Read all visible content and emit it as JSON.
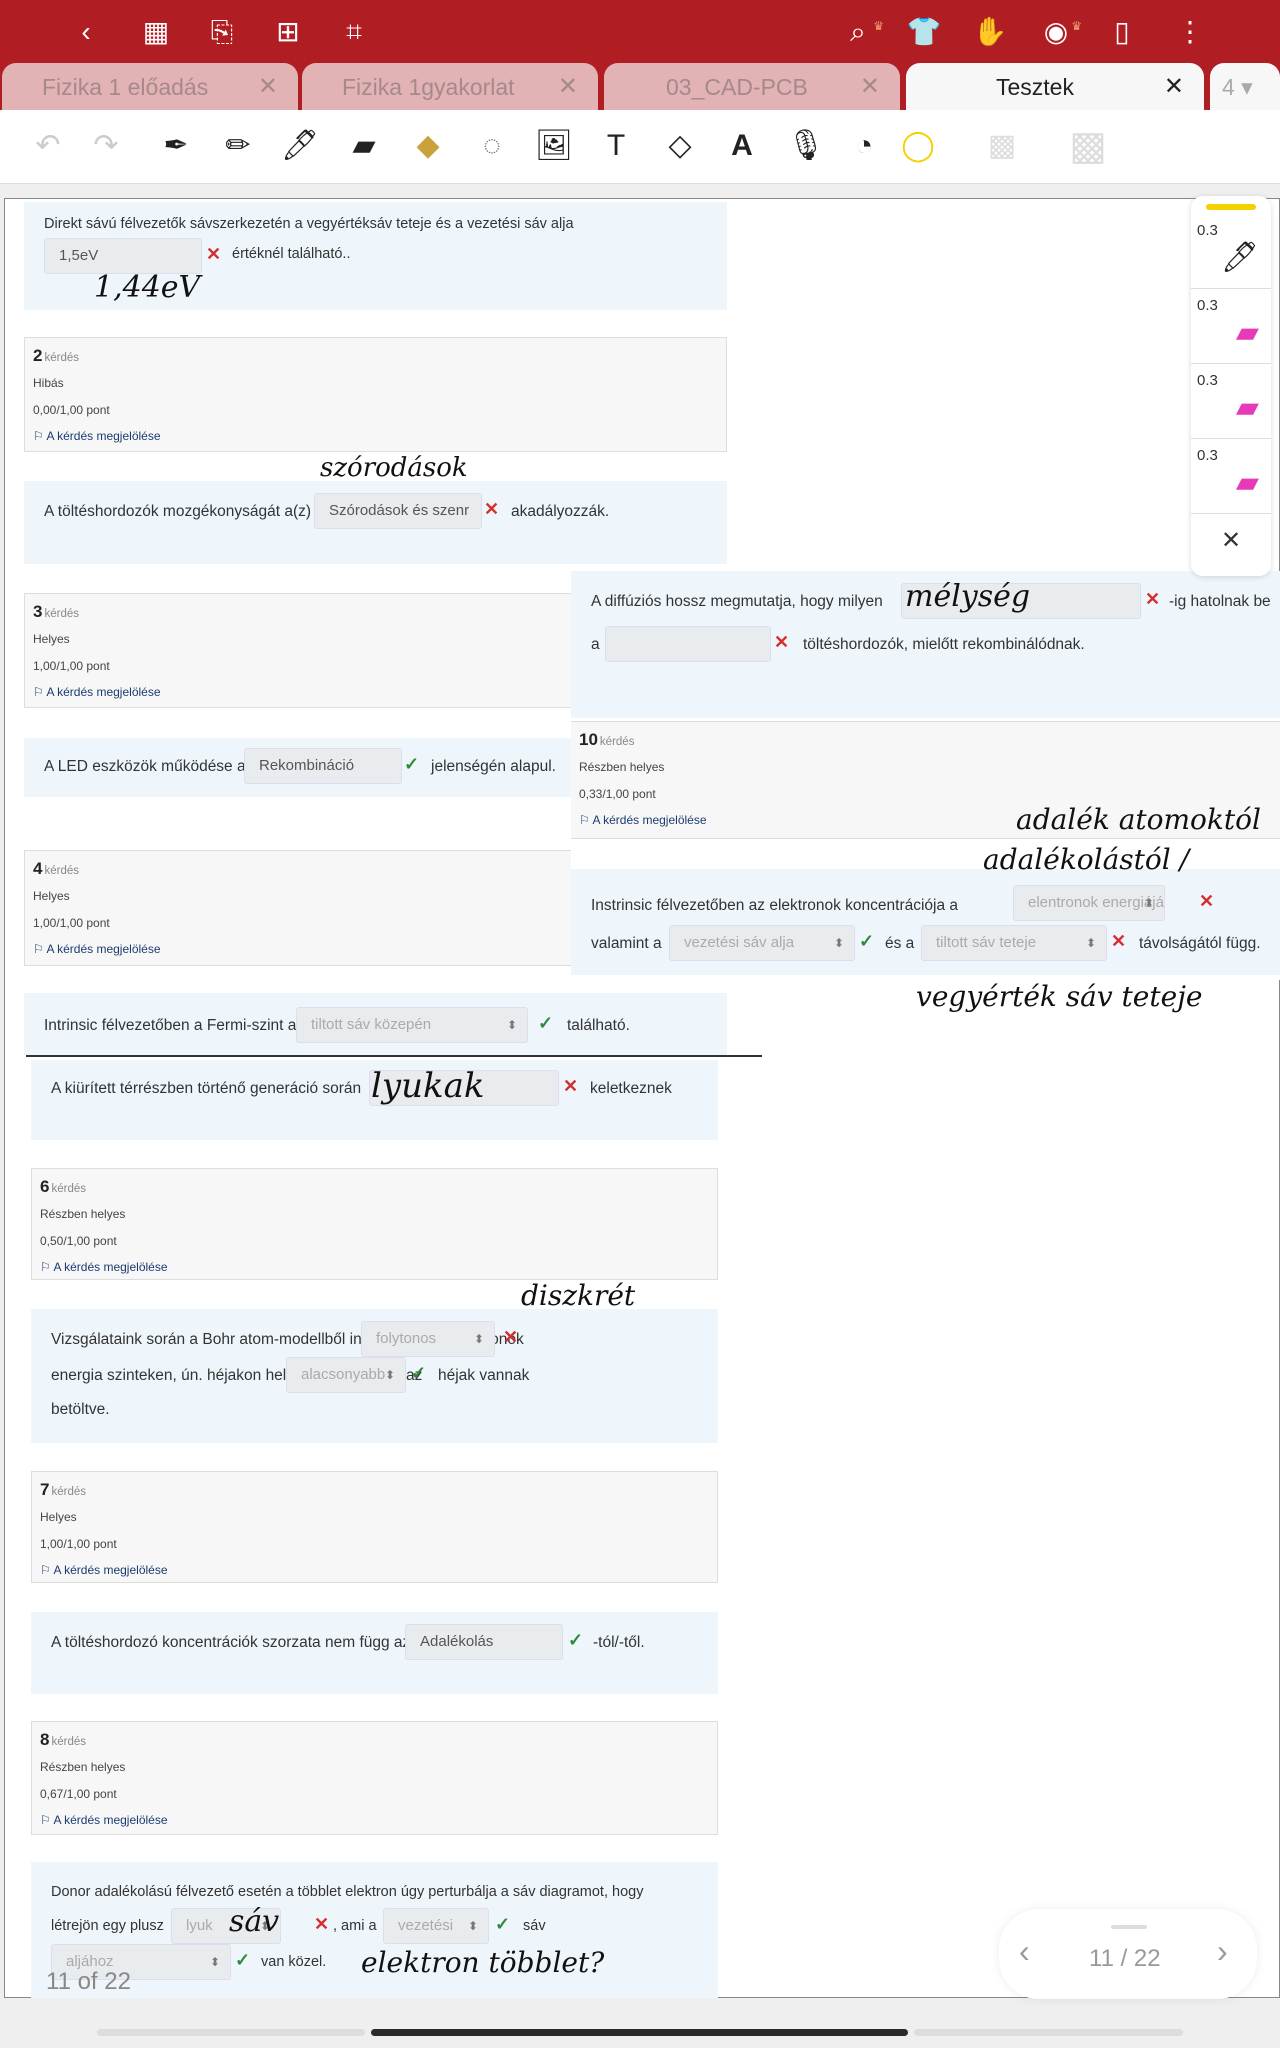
{
  "topbar": {
    "icons": [
      "back-icon",
      "grid-icon",
      "bookmark-icon",
      "add-page-icon",
      "crop-icon",
      "search-icon",
      "shirt-icon",
      "hand-icon",
      "eye-icon",
      "reader-icon",
      "more-icon"
    ]
  },
  "tabs": [
    {
      "label": "Fizika 1 előadás"
    },
    {
      "label": "Fizika 1gyakorlat"
    },
    {
      "label": "03_CAD-PCB"
    },
    {
      "label": "Teszt­ek"
    }
  ],
  "tabs_real": [
    "Fizika 1 előadás",
    "Fizika 1gyakorlat",
    "03_CAD-PCB",
    "Tesztek"
  ],
  "tab_count": "4",
  "tab_close": "✕",
  "toolbar": {
    "tools": [
      "undo-icon",
      "redo-icon",
      "fountain-pen-icon",
      "pencil-icon",
      "ballpoint-pen-icon",
      "highlighter-icon",
      "eraser-icon",
      "lasso-icon",
      "image-icon",
      "text-box-icon",
      "shape-icon",
      "ocr-text-icon",
      "microphone-icon",
      "sticker-icon",
      "color-picker-icon",
      "transparency-icon",
      "background-icon"
    ],
    "active_color": "#f5d000"
  },
  "accent": "#b01e23",
  "labels": {
    "kerdes": "kérdés",
    "flag": "A kérdés megjelölése"
  },
  "q1": {
    "text_a": "Direkt sávú félvezetők sávszerkezetén a vegyértéksáv teteje és a vezetési sáv alja",
    "answer": "1,5eV",
    "text_b": "értéknél található..",
    "note": "1,44eV"
  },
  "q2": {
    "num": "2",
    "status": "Hibás",
    "points": "0,00/1,00 pont",
    "text_a": "A töltéshordozók mozgékonyságát a(z)",
    "answer": "Szórodások és szenr",
    "text_b": "akadályozzák.",
    "note": "szórodások"
  },
  "q3": {
    "num": "3",
    "status": "Helyes",
    "points": "1,00/1,00 pont",
    "text_a": "A LED eszközök működése a",
    "answer": "Rekombináció",
    "text_b": "jelenségén alapul."
  },
  "q4": {
    "num": "4",
    "status": "Helyes",
    "points": "1,00/1,00 pont",
    "text_a": "Intrinsic félvezetőben a Fermi-szint a",
    "answer": "tiltott sáv közepén",
    "text_b": "található."
  },
  "q5": {
    "text_a": "A kiürített térrészben történő generáció során",
    "answer_note": "lyukak",
    "text_b": "keletkeznek"
  },
  "q6": {
    "num": "6",
    "status": "Részben helyes",
    "points": "0,50/1,00 pont",
    "text_a": "Vizsgálataink során a Bohr atom-modellből indulunk ki: az elektronok",
    "answer1": "folytonos",
    "note": "diszkrét",
    "text_b": "energia szinteken, ún. héjakon helyezkednek el, és az",
    "answer2": "alacsonyabb",
    "text_c": "héjak vannak",
    "text_d": "betöltve."
  },
  "q7": {
    "num": "7",
    "status": "Helyes",
    "points": "1,00/1,00 pont",
    "text_a": "A töltéshordozó koncentrációk szorzata nem függ az",
    "answer": "Adalékolás",
    "text_b": "-tól/-től."
  },
  "q8": {
    "num": "8",
    "status": "Részben helyes",
    "points": "0,67/1,00 pont",
    "text_a": "Donor adalékolású félvezető esetén a többlet elektron úgy perturbálja a sáv diagramot, hogy",
    "text_b": "létrejön egy plusz",
    "answer1": "lyuk",
    "note1": "sáv",
    "text_c": ", ami a",
    "answer2": "vezetési",
    "text_d": "sáv",
    "answer3": "aljához",
    "text_e": "van közel.",
    "note2": "elektron többlet?"
  },
  "overlay": {
    "diff": {
      "text_a": "A diffúziós hossz megmutatja, hogy milyen",
      "note": "mélység",
      "text_b": "-ig hatolnak be",
      "text_c": "a",
      "answer2": "",
      "text_d": "töltéshordozók, mielőtt rekombinálódnak."
    },
    "q10": {
      "num": "10",
      "status": "Részben helyes",
      "points": "0,33/1,00 pont"
    },
    "intr": {
      "text_a": "Instrinsic félvezetőben az elektronok koncentrációja a",
      "answer1": "elentronok energiájától",
      "text_b": "valamint a",
      "answer2": "vezetési sáv alja",
      "text_c": "és a",
      "answer3": "tiltott sáv teteje",
      "text_d": "távolságától függ.",
      "note1": "adalék atomoktól",
      "note2": "adalékolástól /",
      "note3": "vegyérték sáv teteje"
    }
  },
  "pens": [
    {
      "size": "0.3",
      "type": "ballpoint-pen-icon",
      "color": "#222222"
    },
    {
      "size": "0.3",
      "type": "highlighter-icon",
      "color": "#e83ab8"
    },
    {
      "size": "0.3",
      "type": "highlighter-icon",
      "color": "#e83ab8"
    },
    {
      "size": "0.3",
      "type": "highlighter-icon",
      "color": "#e83ab8"
    }
  ],
  "pen_close": "✕",
  "footer": {
    "page_label": "11 of 22",
    "pager": "11 / 22"
  }
}
